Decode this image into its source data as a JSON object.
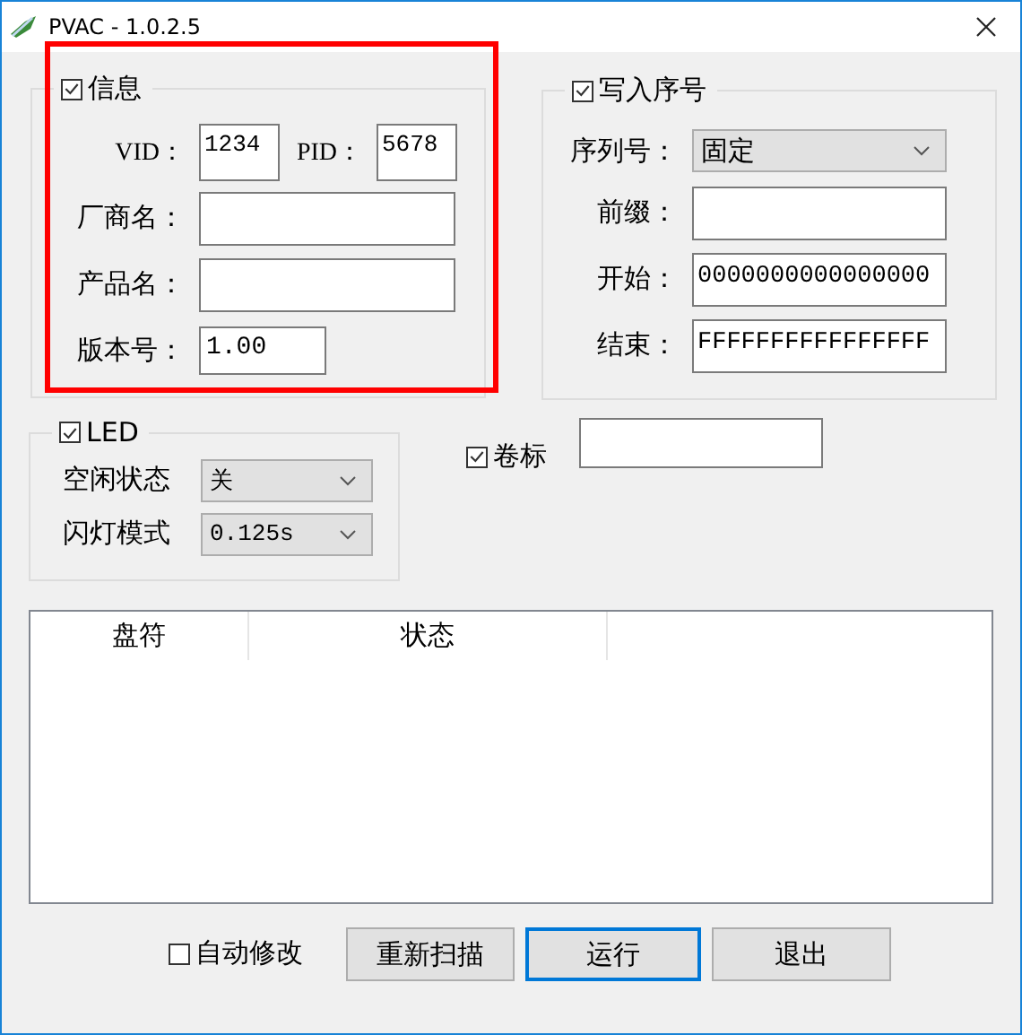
{
  "window": {
    "title": "PVAC - 1.0.2.5"
  },
  "info": {
    "label": "信息",
    "checked": true,
    "highlighted": true,
    "vid_label": "VID：",
    "vid": "1234",
    "pid_label": "PID：",
    "pid": "5678",
    "fields": [
      {
        "label": "厂商名："
      },
      {
        "label": "产品名："
      },
      {
        "label": "版本号：",
        "value": "1.00",
        "kind": "short"
      }
    ]
  },
  "serial": {
    "label": "写入序号",
    "checked": true,
    "mode_label": "序列号：",
    "mode": "固定",
    "fields": [
      {
        "label": "前缀："
      },
      {
        "label": "开始：",
        "value": "0000000000000000"
      },
      {
        "label": "结束：",
        "value": "FFFFFFFFFFFFFFFF"
      }
    ]
  },
  "led": {
    "label": "LED",
    "checked": true,
    "selects": [
      {
        "label": "空闲状态",
        "value": "关"
      },
      {
        "label": "闪灯模式",
        "value": "0.125s"
      }
    ]
  },
  "volume": {
    "label": "卷标",
    "checked": true
  },
  "table": {
    "columns": [
      "盘符",
      "状态"
    ]
  },
  "auto_modify": {
    "label": "自动修改",
    "checked": false
  },
  "buttons": [
    {
      "label": "重新扫描",
      "focused": false
    },
    {
      "label": "运行",
      "focused": true
    },
    {
      "label": "退出",
      "focused": false
    }
  ]
}
